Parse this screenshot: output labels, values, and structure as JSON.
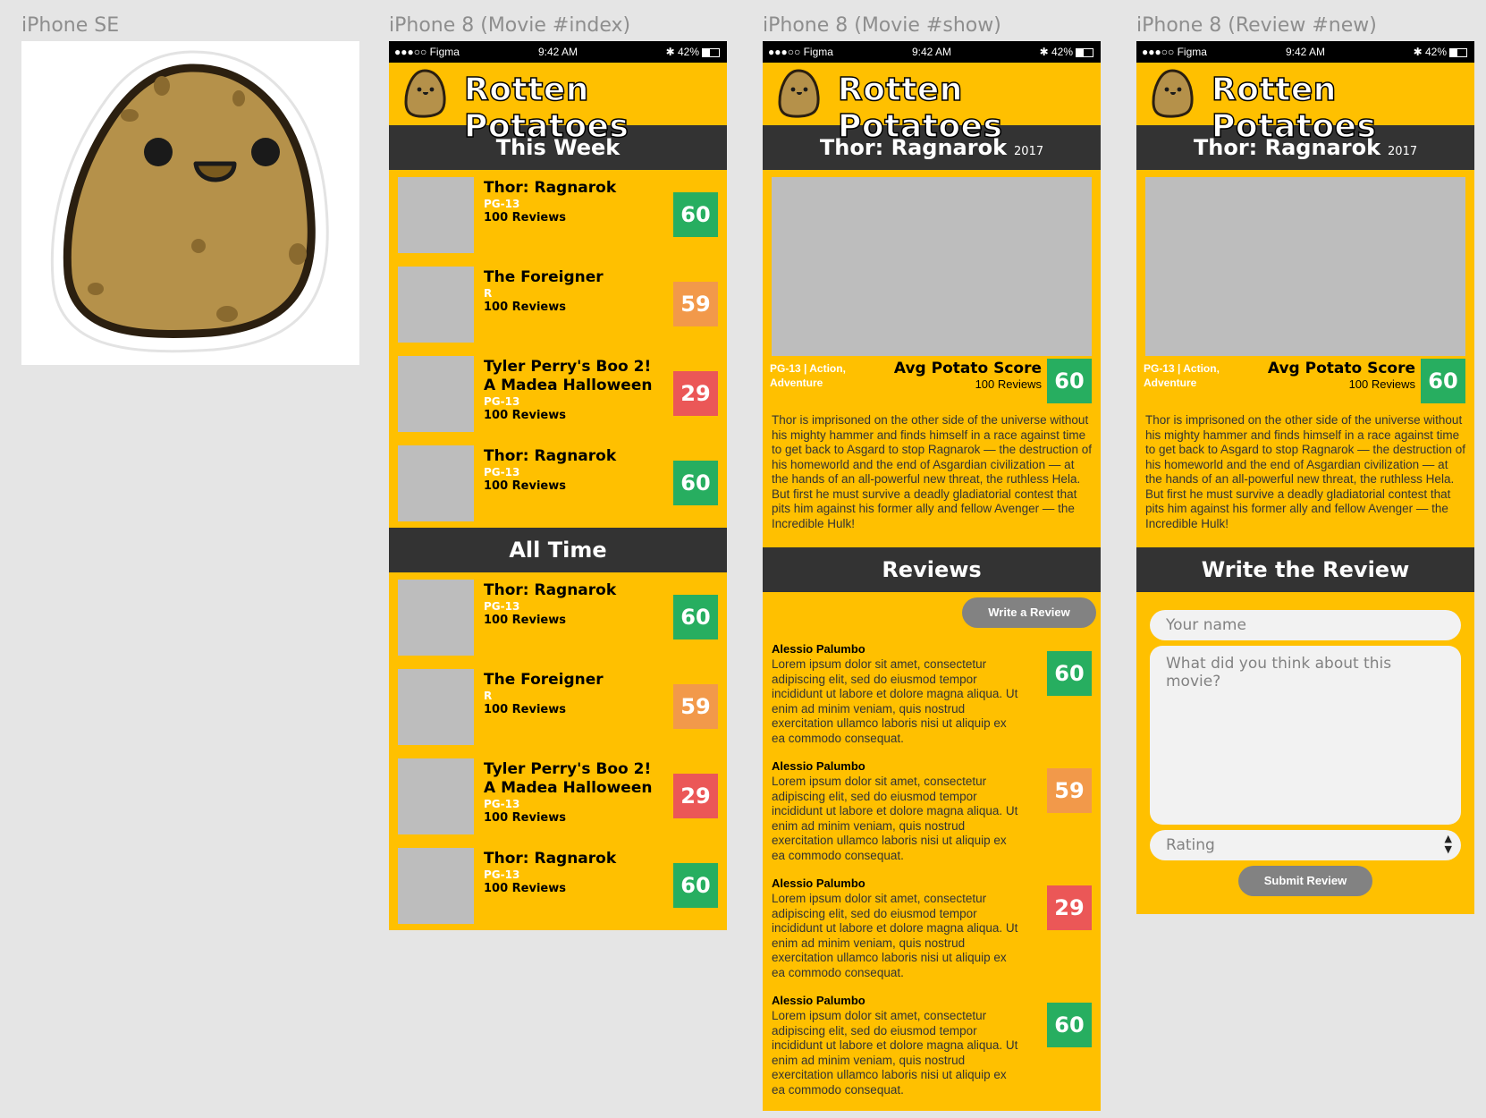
{
  "frames": {
    "se_label": "iPhone SE",
    "index_label": "iPhone 8 (Movie #index)",
    "show_label": "iPhone 8 (Movie #show)",
    "new_label": "iPhone 8 (Review #new)"
  },
  "status": {
    "carrier": "●●●○○ Figma",
    "time": "9:42 AM",
    "battery": "✱ 42%"
  },
  "app": {
    "title": "Rotten Potatoes"
  },
  "colors": {
    "brand_yellow": "#ffc000",
    "bar_dark": "#333333",
    "score_green": "#27ae60",
    "score_orange": "#f2994a",
    "score_red": "#eb5757",
    "button_gray": "#828282"
  },
  "index": {
    "this_week_title": "This Week",
    "all_time_title": "All Time",
    "this_week": [
      {
        "title": "Thor: Ragnarok",
        "rating": "PG-13",
        "reviews": "100 Reviews",
        "score": "60",
        "color": "green"
      },
      {
        "title": "The Foreigner",
        "rating": "R",
        "reviews": "100 Reviews",
        "score": "59",
        "color": "orange"
      },
      {
        "title": "Tyler Perry's Boo 2! A Madea Halloween",
        "rating": "PG-13",
        "reviews": "100 Reviews",
        "score": "29",
        "color": "red"
      },
      {
        "title": "Thor: Ragnarok",
        "rating": "PG-13",
        "reviews": "100 Reviews",
        "score": "60",
        "color": "green"
      }
    ],
    "all_time": [
      {
        "title": "Thor: Ragnarok",
        "rating": "PG-13",
        "reviews": "100 Reviews",
        "score": "60",
        "color": "green"
      },
      {
        "title": "The Foreigner",
        "rating": "R",
        "reviews": "100 Reviews",
        "score": "59",
        "color": "orange"
      },
      {
        "title": "Tyler Perry's Boo 2! A Madea Halloween",
        "rating": "PG-13",
        "reviews": "100 Reviews",
        "score": "29",
        "color": "red"
      },
      {
        "title": "Thor: Ragnarok",
        "rating": "PG-13",
        "reviews": "100 Reviews",
        "score": "60",
        "color": "green"
      }
    ]
  },
  "show": {
    "title": "Thor: Ragnarok",
    "year": "2017",
    "meta": "PG-13 | Action, Adventure",
    "avg_label": "Avg Potato Score",
    "avg_reviews": "100 Reviews",
    "avg_score": "60",
    "synopsis": "Thor is imprisoned on the other side of the universe without his mighty hammer and finds himself in a race against time to get back to Asgard to stop Ragnarok — the destruction of his homeworld and the end of Asgardian civilization — at the hands of an all-powerful new threat, the ruthless Hela. But first he must survive a deadly gladiatorial contest that pits him against his former ally and fellow Avenger — the Incredible Hulk!",
    "reviews_title": "Reviews",
    "write_button": "Write a Review",
    "reviews": [
      {
        "author": "Alessio Palumbo",
        "text": "Lorem ipsum dolor sit amet, consectetur adipiscing elit, sed do eiusmod tempor incididunt ut labore et dolore magna aliqua. Ut enim ad minim veniam, quis nostrud exercitation ullamco laboris nisi ut aliquip ex ea commodo consequat.",
        "score": "60",
        "color": "green"
      },
      {
        "author": "Alessio Palumbo",
        "text": "Lorem ipsum dolor sit amet, consectetur adipiscing elit, sed do eiusmod tempor incididunt ut labore et dolore magna aliqua. Ut enim ad minim veniam, quis nostrud exercitation ullamco laboris nisi ut aliquip ex ea commodo consequat.",
        "score": "59",
        "color": "orange"
      },
      {
        "author": "Alessio Palumbo",
        "text": "Lorem ipsum dolor sit amet, consectetur adipiscing elit, sed do eiusmod tempor incididunt ut labore et dolore magna aliqua. Ut enim ad minim veniam, quis nostrud exercitation ullamco laboris nisi ut aliquip ex ea commodo consequat.",
        "score": "29",
        "color": "red"
      },
      {
        "author": "Alessio Palumbo",
        "text": "Lorem ipsum dolor sit amet, consectetur adipiscing elit, sed do eiusmod tempor incididunt ut labore et dolore magna aliqua. Ut enim ad minim veniam, quis nostrud exercitation ullamco laboris nisi ut aliquip ex ea commodo consequat.",
        "score": "60",
        "color": "green"
      }
    ]
  },
  "new_review": {
    "form_title": "Write the Review",
    "name_placeholder": "Your name",
    "body_placeholder": "What did you think about this movie?",
    "rating_placeholder": "Rating",
    "submit_button": "Submit Review"
  }
}
